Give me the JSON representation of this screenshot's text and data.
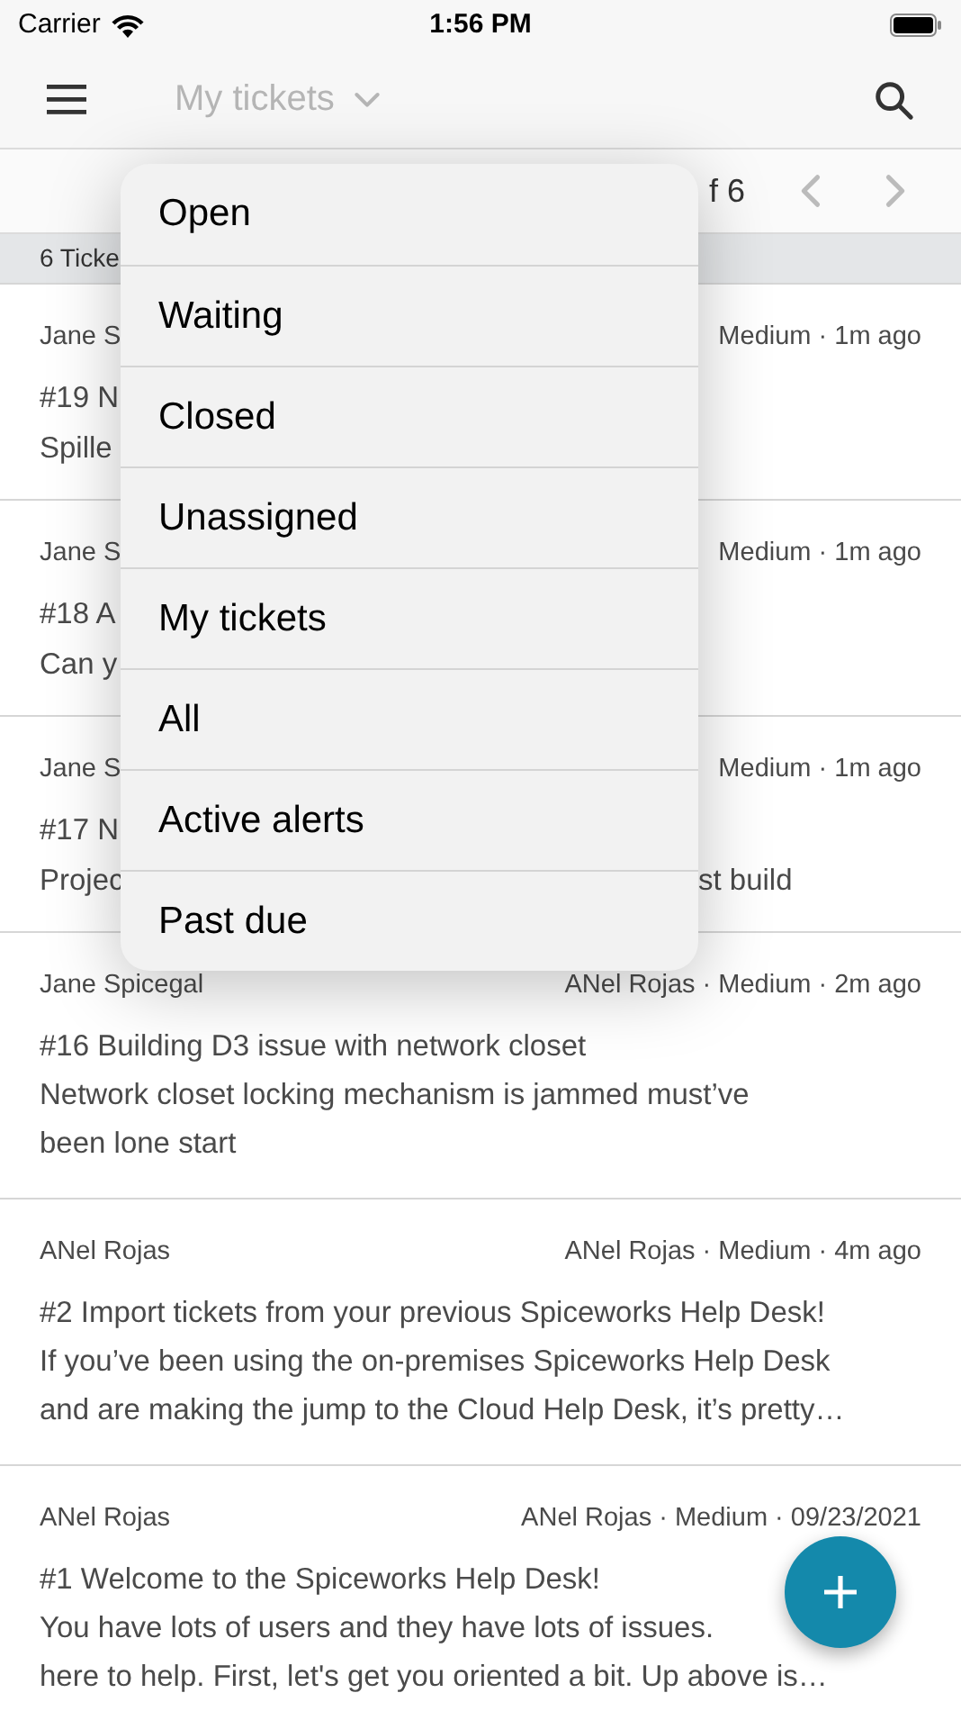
{
  "status_bar": {
    "carrier": "Carrier",
    "time": "1:56 PM"
  },
  "nav": {
    "title": "My tickets",
    "dimmed": true
  },
  "pagination": {
    "text": "f 6"
  },
  "list_header": {
    "count": "6 Ticke"
  },
  "tickets": [
    {
      "kind": "covered",
      "requester": "Jane S",
      "meta": "Medium · 1m ago",
      "lines": [
        {
          "left": "#19 N"
        },
        {
          "left": "Spille"
        }
      ]
    },
    {
      "kind": "covered",
      "requester": "Jane S",
      "meta": "Medium · 1m ago",
      "lines": [
        {
          "left": "#18 A"
        },
        {
          "left": "Can y"
        }
      ]
    },
    {
      "kind": "covered",
      "requester": "Jane S",
      "meta": "Medium · 1m ago",
      "lines": [
        {
          "left": "#17 N"
        },
        {
          "left": "Projec",
          "right": "st build"
        }
      ]
    },
    {
      "kind": "full",
      "requester": "Jane Spicegal",
      "meta": "ANel Rojas · Medium · 2m ago",
      "lines": [
        "#16 Building D3 issue with network closet",
        "Network closet locking mechanism is jammed must’ve",
        "been lone start"
      ]
    },
    {
      "kind": "full",
      "requester": "ANel Rojas",
      "meta": "ANel Rojas · Medium · 4m ago",
      "lines": [
        "#2 Import tickets from your previous Spiceworks Help Desk!",
        "If you’ve been using the on-premises Spiceworks Help Desk",
        "and are making the jump to the Cloud Help Desk, it’s pretty…"
      ]
    },
    {
      "kind": "full",
      "requester": "ANel Rojas",
      "meta": "ANel Rojas · Medium · 09/23/2021",
      "lines": [
        "#1 Welcome to the Spiceworks Help Desk!",
        "You have lots of users and they have lots of issues.",
        "here to help. First, let's get you oriented a bit. Up above is…"
      ]
    }
  ],
  "filter_menu": {
    "items": [
      "Open",
      "Waiting",
      "Closed",
      "Unassigned",
      "My tickets",
      "All",
      "Active alerts",
      "Past due"
    ]
  }
}
